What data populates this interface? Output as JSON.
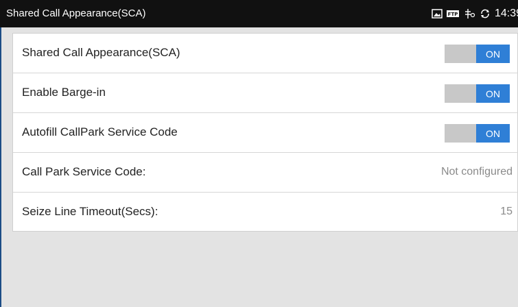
{
  "status_bar": {
    "title": "Shared Call Appearance(SCA)",
    "time": "14:39",
    "icons": [
      "image-icon",
      "ftp-icon",
      "usb-icon",
      "sync-icon"
    ]
  },
  "settings": [
    {
      "label": "Shared Call Appearance(SCA)",
      "type": "toggle",
      "state": "ON"
    },
    {
      "label": "Enable Barge-in",
      "type": "toggle",
      "state": "ON"
    },
    {
      "label": "Autofill CallPark Service Code",
      "type": "toggle",
      "state": "ON"
    },
    {
      "label": "Call Park Service Code:",
      "type": "value",
      "value": "Not configured"
    },
    {
      "label": "Seize Line Timeout(Secs):",
      "type": "value",
      "value": "15"
    }
  ],
  "colors": {
    "toggle_on": "#2f7fd6",
    "toggle_off": "#c8c8c8",
    "status_bar": "#111111",
    "background": "#e3e3e3"
  }
}
